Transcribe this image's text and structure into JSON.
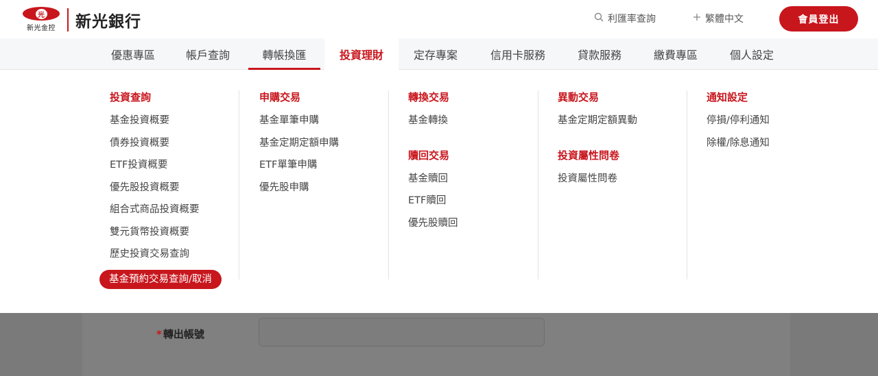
{
  "brand": {
    "emblem_char": "光",
    "holding_name": "新光金控",
    "bank_name": "新光銀行"
  },
  "utility": {
    "rate_query": "利匯率查詢",
    "language": "繁體中文",
    "logout": "會員登出"
  },
  "nav": {
    "items": [
      "優惠專區",
      "帳戶查詢",
      "轉帳換匯",
      "投資理財",
      "定存專案",
      "信用卡服務",
      "貸款服務",
      "繳費專區",
      "個人設定"
    ],
    "underlined": "轉帳換匯",
    "active": "投資理財"
  },
  "menu": {
    "col1": {
      "title": "投資查詢",
      "links": [
        "基金投資概要",
        "債券投資概要",
        "ETF投資概要",
        "優先股投資概要",
        "組合式商品投資概要",
        "雙元貨幣投資概要",
        "歷史投資交易查詢",
        "基金預約交易查詢/取消"
      ]
    },
    "col2": {
      "title": "申購交易",
      "links": [
        "基金單筆申購",
        "基金定期定額申購",
        "ETF單筆申購",
        "優先股申購"
      ]
    },
    "col3": {
      "title": "轉換交易",
      "links": [
        "基金轉換"
      ],
      "title2": "贖回交易",
      "links2": [
        "基金贖回",
        "ETF贖回",
        "優先股贖回"
      ]
    },
    "col4": {
      "title": "異動交易",
      "links": [
        "基金定期定額異動"
      ],
      "title2": "投資屬性問卷",
      "links2": [
        "投資屬性問卷"
      ]
    },
    "col5": {
      "title": "通知設定",
      "links": [
        "停損/停利通知",
        "除權/除息通知"
      ]
    }
  },
  "form": {
    "required_mark": "*",
    "from_account_label": "轉出帳號"
  }
}
